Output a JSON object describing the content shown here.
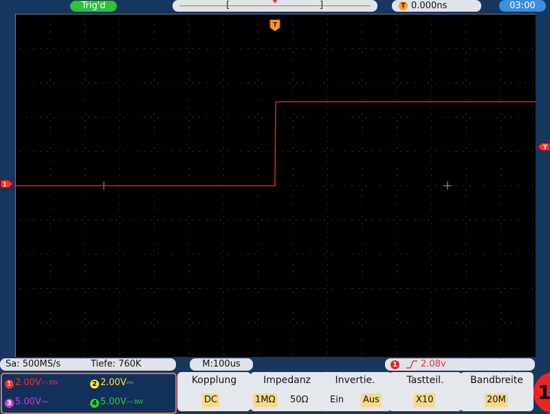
{
  "header": {
    "trigger_status": "Trig'd",
    "timebase_bracket_left": "[",
    "timebase_bracket_right": "]",
    "horizontal_position_icon": "T",
    "horizontal_position": "0.000ns",
    "clock": "03:00"
  },
  "scope": {
    "trigger_marker_label": "T",
    "ch1_marker_label": "1",
    "trigger_level_marker_label": "T",
    "trace_color": "#e02020",
    "grid_color": "#6b6b6b"
  },
  "status": {
    "sample_rate": "Sa: 500MS/s",
    "depth": "Tiefe: 760K",
    "timebase": "M:100us",
    "trigger_channel": "1",
    "trigger_edge_icon": "rising-edge-icon",
    "trigger_level": "2.08v"
  },
  "channels": [
    {
      "num": "1",
      "value": "2.00V",
      "coupling": "⎓",
      "suffix": "BW",
      "color": "#ff2a2a"
    },
    {
      "num": "2",
      "value": "2.00V",
      "coupling": "⎓",
      "suffix": "",
      "color": "#ffea2a"
    },
    {
      "num": "3",
      "value": "5.00V",
      "coupling": "~",
      "suffix": "",
      "color": "#d23ad8"
    },
    {
      "num": "4",
      "value": "5.00V",
      "coupling": "⎓",
      "suffix": "BW",
      "color": "#27d627"
    }
  ],
  "menu": {
    "kopplung": {
      "title": "Kopplung",
      "options": [
        "DC"
      ]
    },
    "impedanz": {
      "title": "Impedanz",
      "options": [
        "1MΩ",
        "50Ω"
      ]
    },
    "invertie": {
      "title": "Invertie.",
      "options": [
        "Ein",
        "Aus"
      ]
    },
    "tastteil": {
      "title": "Tastteil.",
      "options": [
        "X10"
      ]
    },
    "bandbreite": {
      "title": "Bandbreite",
      "options": [
        "20M"
      ]
    }
  },
  "active_channel": "1"
}
